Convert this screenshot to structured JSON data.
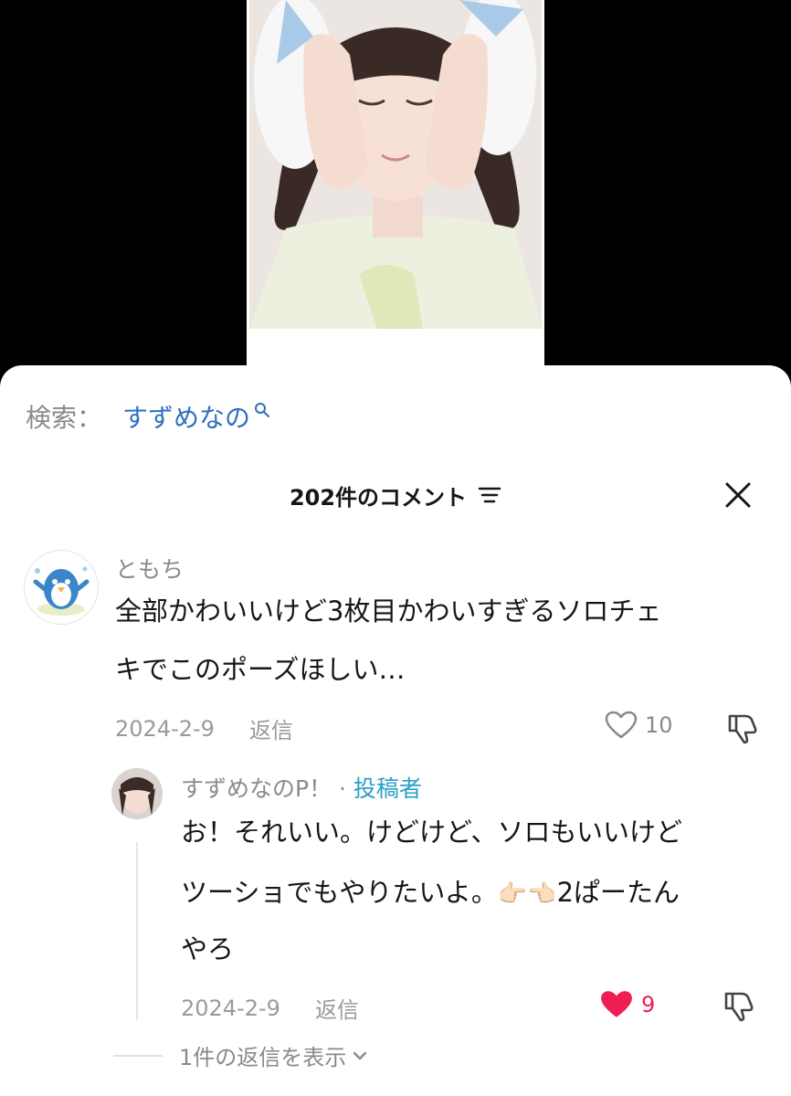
{
  "search": {
    "prefix": "検索：",
    "term": "すずめなの"
  },
  "comments_header": {
    "title": "202件のコメント"
  },
  "comments": [
    {
      "username": "ともち",
      "text_line1": "全部かわいいけど3枚目かわいすぎるソロチェ",
      "text_line2": "キでこのポーズほしい…",
      "date": "2024-2-9",
      "reply_label": "返信",
      "likes": "10",
      "liked": false
    }
  ],
  "reply": {
    "username": "すずめなのP！",
    "separator": " · ",
    "author_badge": "投稿者",
    "text_line1": "お！それいい。けどけど、ソロもいいけど",
    "text_line2_start": "ツーショでもやりたいよ。",
    "text_line2_emoji": "👉🏻👈🏻",
    "text_line2_end": "2ぱーたん",
    "text_line3": "やろ",
    "date": "2024-2-9",
    "reply_label": "返信",
    "likes": "9",
    "liked": true,
    "liked_color": "#ee1d52"
  },
  "view_replies": {
    "label": "1件の返信を表示"
  },
  "colors": {
    "link_blue": "#2f6fbf",
    "author_badge": "#2ba0c8",
    "heart_red": "#ee1d52"
  },
  "icons": [
    "search-icon",
    "sort-icon",
    "close-icon",
    "heart-outline-icon",
    "heart-filled-icon",
    "dislike-icon",
    "chevron-down-icon"
  ]
}
